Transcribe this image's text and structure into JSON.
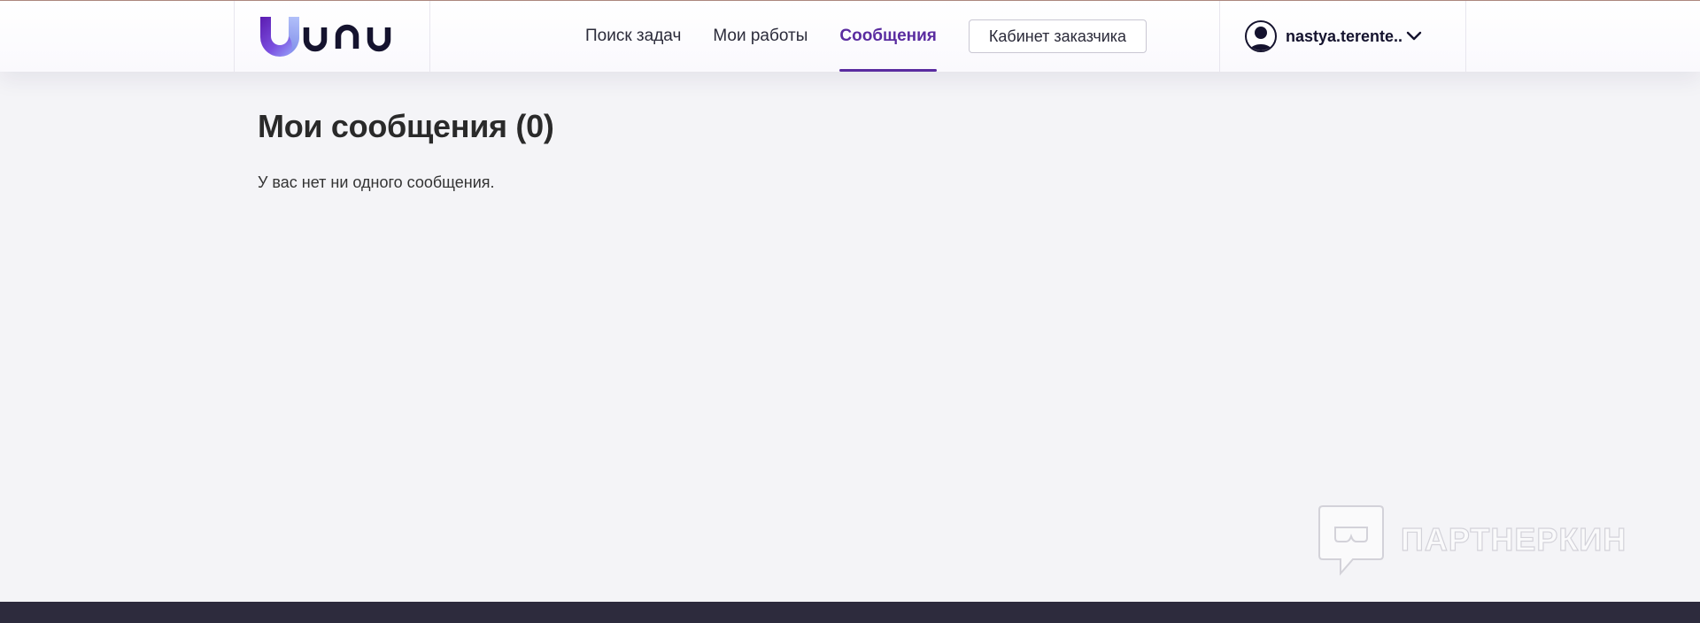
{
  "header": {
    "logo_text": "unu",
    "nav": [
      {
        "label": "Поиск задач",
        "active": false
      },
      {
        "label": "Мои работы",
        "active": false
      },
      {
        "label": "Сообщения",
        "active": true
      }
    ],
    "cabinet_button": "Кабинет заказчика",
    "user": {
      "name": "nastya.terente.."
    }
  },
  "main": {
    "title": "Мои сообщения (0)",
    "empty_message": "У вас нет ни одного сообщения."
  },
  "watermark": {
    "text": "ПАРТНЕРКИН"
  },
  "colors": {
    "accent": "#5a2ca0",
    "background": "#f4f4f7",
    "footer": "#2d2b3d",
    "logo_dark": "#15132e"
  },
  "icons": {
    "avatar": "user-avatar-icon",
    "dropdown": "chevron-down-icon",
    "watermark": "speech-bubble-icon"
  }
}
